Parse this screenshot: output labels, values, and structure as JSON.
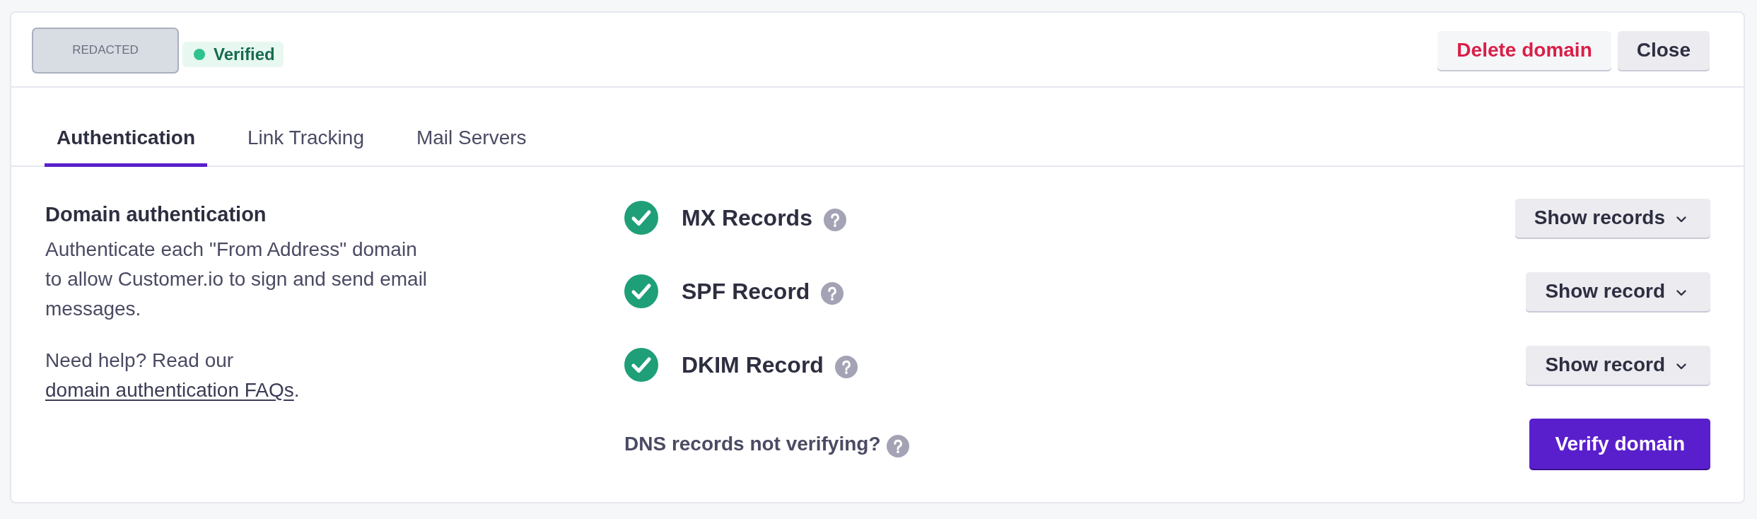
{
  "header": {
    "domain": "REDACTED",
    "status": "Verified",
    "buttons": [
      {
        "label": "Delete domain",
        "kind": "danger"
      },
      {
        "label": "Close",
        "kind": "secondary"
      }
    ]
  },
  "tabs": [
    {
      "label": "Authentication",
      "selected": true
    },
    {
      "label": "Link Tracking",
      "selected": false
    },
    {
      "label": "Mail Servers",
      "selected": false
    }
  ],
  "section": {
    "title": "Domain authentication",
    "description": "Authenticate each \"From Address\" domain to allow Customer.io to sign and send email messages.",
    "help_prefix": "Need help? Read our ",
    "help_link": "domain authentication FAQs",
    "help_suffix": "."
  },
  "records": [
    {
      "name": "MX Records",
      "verified": true,
      "button": "Show records"
    },
    {
      "name": "SPF Record",
      "verified": true,
      "button": "Show record"
    },
    {
      "name": "DKIM Record",
      "verified": true,
      "button": "Show record"
    }
  ],
  "footer": {
    "question": "DNS records not verifying?",
    "button": "Verify domain"
  }
}
